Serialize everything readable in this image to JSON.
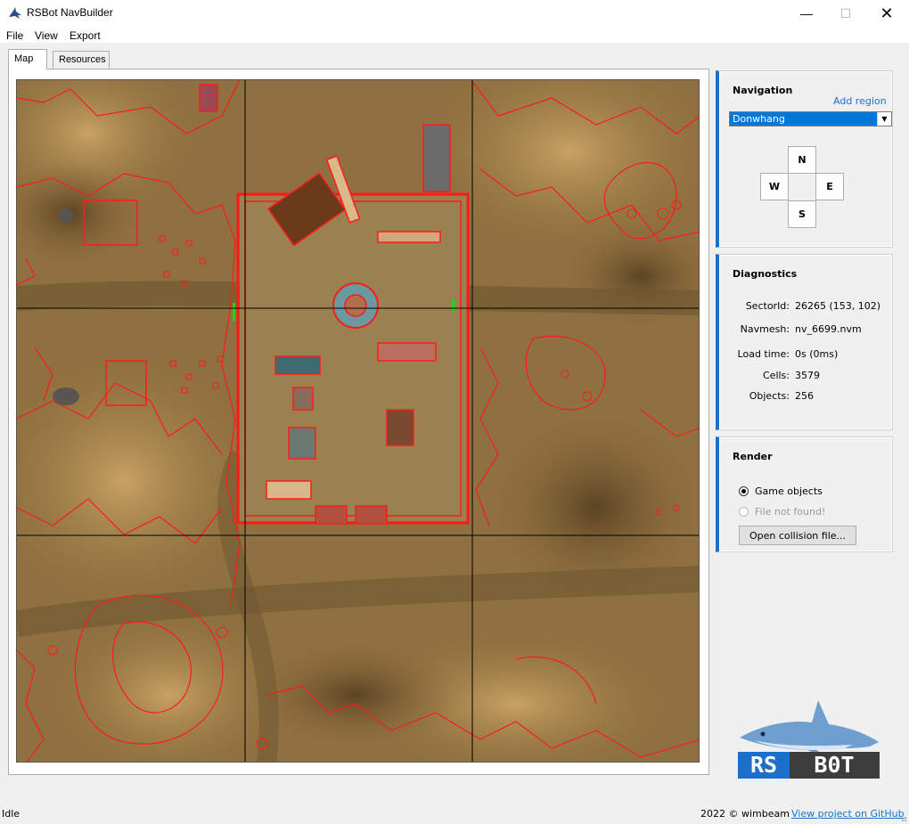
{
  "window": {
    "title": "RSBot NavBuilder",
    "minimize": "—",
    "maximize": "☐",
    "close": "✕"
  },
  "menu": [
    "File",
    "View",
    "Export"
  ],
  "tabs": [
    {
      "label": "Map",
      "active": true
    },
    {
      "label": "Resources",
      "active": false
    }
  ],
  "navigation": {
    "title": "Navigation",
    "add_region": "Add region",
    "region": "Donwhang",
    "directions": {
      "n": "N",
      "w": "W",
      "e": "E",
      "s": "S"
    }
  },
  "diagnostics": {
    "title": "Diagnostics",
    "rows": [
      {
        "label": "SectorId:",
        "value": "26265 (153, 102)"
      },
      {
        "label": "Navmesh:",
        "value": "nv_6699.nvm"
      },
      {
        "label": "Load time:",
        "value": "0s (0ms)"
      },
      {
        "label": "Cells:",
        "value": "3579"
      },
      {
        "label": "Objects:",
        "value": "256"
      }
    ]
  },
  "render": {
    "title": "Render",
    "option_game_objects": "Game objects",
    "option_file": "File not found!",
    "open_button": "Open collision file..."
  },
  "logo": {
    "text_a": "RS",
    "text_b": "B0T"
  },
  "status": {
    "left": "Idle",
    "copyright": "2022 © wimbeam",
    "github_link": "View project on GitHub"
  },
  "colors": {
    "accent": "#1e6fc9",
    "navmesh": "#ff1a1a",
    "terrain": "#8a6a3a"
  }
}
